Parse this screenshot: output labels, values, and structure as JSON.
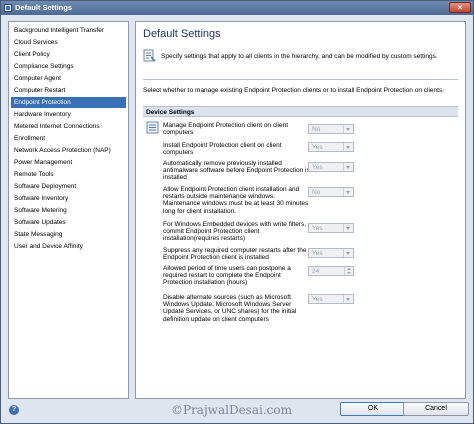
{
  "window": {
    "title": "Default Settings"
  },
  "sidebar": {
    "selected_index": 8,
    "items": [
      {
        "label": "Background Intelligent Transfer"
      },
      {
        "label": "Cloud Services"
      },
      {
        "label": "Client Policy"
      },
      {
        "label": "Compliance Settings"
      },
      {
        "label": "Computer Agent"
      },
      {
        "label": "Computer Restart"
      },
      {
        "label": "Endpoint Protection"
      },
      {
        "label": "Hardware Inventory"
      },
      {
        "label": "Metered Internet Connections"
      },
      {
        "label": "Enrollment"
      },
      {
        "label": "Network Access Protection (NAP)"
      },
      {
        "label": "Power Management"
      },
      {
        "label": "Remote Tools"
      },
      {
        "label": "Software Deployment"
      },
      {
        "label": "Software Inventory"
      },
      {
        "label": "Software Metering"
      },
      {
        "label": "Software Updates"
      },
      {
        "label": "State Messaging"
      },
      {
        "label": "User and Device Affinity"
      }
    ]
  },
  "main": {
    "title": "Default Settings",
    "description": "Specify settings that apply to all clients in the hierarchy, and can be modified by custom settings.",
    "instructions": "Select whether to manage existing Endpoint Protection clients or to install Endpoint Protection on clients.",
    "section_title": "Device Settings",
    "settings": [
      {
        "label": "Manage Endpoint Protection client on client computers",
        "control": "dropdown",
        "value": "No"
      },
      {
        "label": "Install Endpoint Protection client on client computers",
        "control": "dropdown",
        "value": "Yes"
      },
      {
        "label": "Automatically remove previously installed antimalware software before Endpoint Protection is installed",
        "control": "dropdown",
        "value": "Yes"
      },
      {
        "label": "Allow Endpoint Protection client installation and restarts outside maintenance windows. Maintenance windows must be at least 30 minutes long for client installation.",
        "control": "dropdown",
        "value": "No"
      },
      {
        "label": "For Windows Embedded devices with write filters, commit Endpoint Protection client installation(requires restarts)",
        "control": "dropdown",
        "value": "Yes"
      },
      {
        "label": "Suppress any required computer restarts after the Endpoint Protection client is installed",
        "control": "dropdown",
        "value": "Yes"
      },
      {
        "label": "Allowed period of time users can postpone a required restart to complete the Endpoint Protection installation (hours)",
        "control": "spinner",
        "value": "24"
      },
      {
        "label": "Disable alternate sources (such as Microsoft Windows Update, Microsoft Windows Server Update Services, or UNC shares) for the initial definition update on client computers",
        "control": "dropdown",
        "value": "Yes"
      }
    ]
  },
  "footer": {
    "help_icon": "help-icon",
    "watermark": "©PrajwalDesai.com",
    "ok_label": "OK",
    "cancel_label": "Cancel"
  }
}
